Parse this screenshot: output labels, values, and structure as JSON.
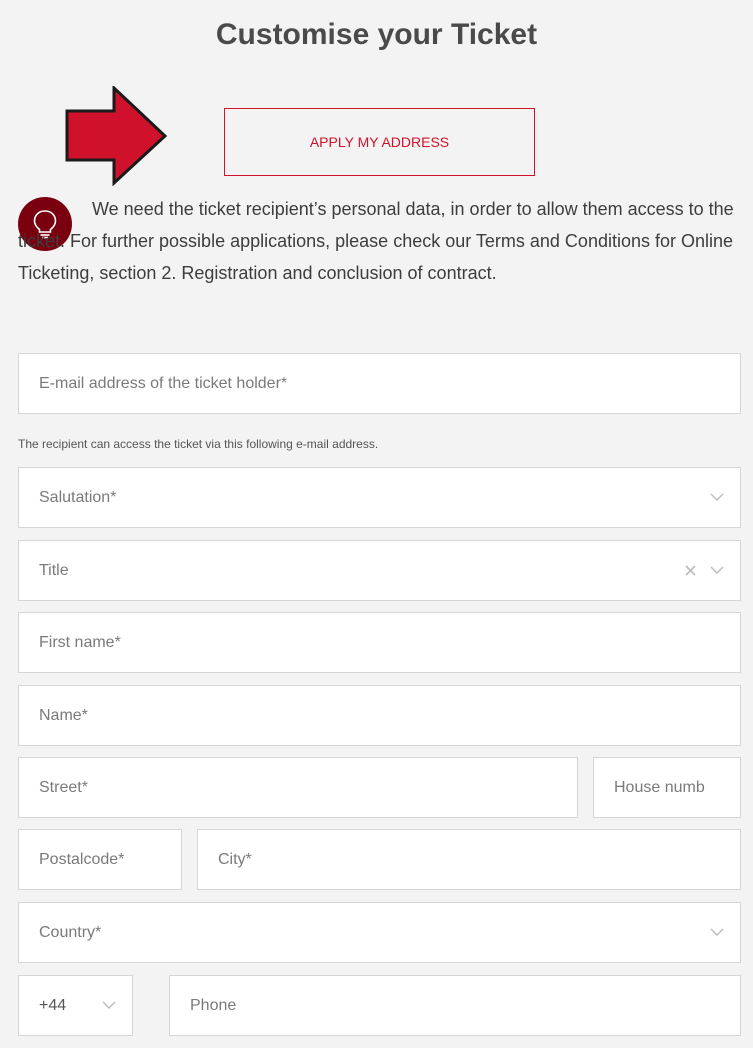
{
  "page": {
    "title": "Customise your Ticket"
  },
  "apply_button": {
    "label": "APPLY MY ADDRESS"
  },
  "info": {
    "icon": "lightbulb-icon",
    "text": "We need the ticket recipient’s personal data, in order to allow them access to the ticket. For further possible applications, please check our Terms and Conditions for Online Ticketing, section 2. Registration and conclusion of contract."
  },
  "form": {
    "email": {
      "placeholder": "E-mail address of the ticket holder*"
    },
    "email_hint": "The recipient can access the ticket via this following e-mail address.",
    "salutation": {
      "placeholder": "Salutation*"
    },
    "title": {
      "placeholder": "Title"
    },
    "first_name": {
      "placeholder": "First name*"
    },
    "name": {
      "placeholder": "Name*"
    },
    "street": {
      "placeholder": "Street*"
    },
    "house_number": {
      "placeholder": "House numb"
    },
    "postalcode": {
      "placeholder": "Postalcode*"
    },
    "city": {
      "placeholder": "City*"
    },
    "country": {
      "placeholder": "Country*"
    },
    "phone_prefix": {
      "value": "+44"
    },
    "phone": {
      "placeholder": "Phone"
    }
  },
  "colors": {
    "accent": "#d0112b",
    "icon_bg": "#7a0010",
    "background": "#f3f3f3"
  }
}
